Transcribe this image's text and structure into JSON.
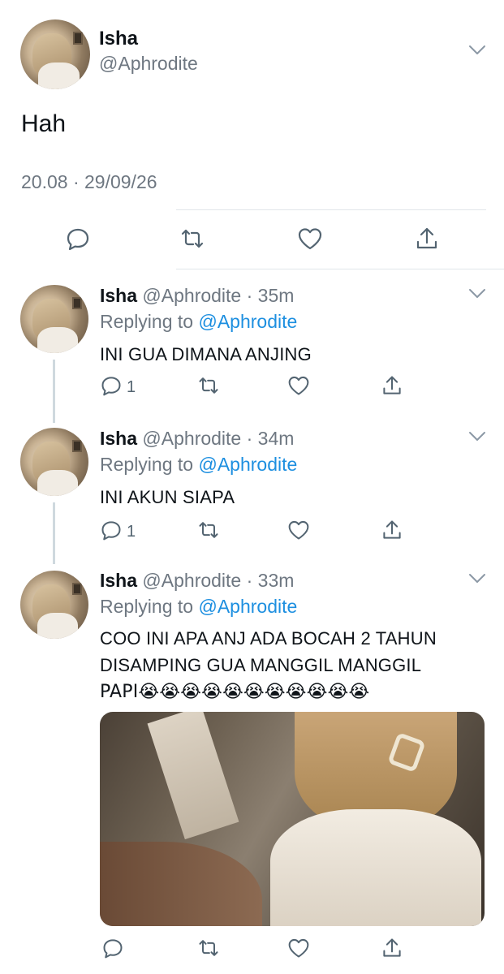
{
  "main_tweet": {
    "name": "Isha",
    "handle": "@Aphrodite",
    "text": "Hah",
    "timestamp": "20.08 · 29/09/26"
  },
  "replies": [
    {
      "name": "Isha",
      "meta": "@Aphrodite · 35m",
      "replying_prefix": "Replying to ",
      "replying_to": "@Aphrodite",
      "text": "INI GUA DIMANA ANJING",
      "reply_count": "1"
    },
    {
      "name": "Isha",
      "meta": "@Aphrodite · 34m",
      "replying_prefix": "Replying to ",
      "replying_to": "@Aphrodite",
      "text": "INI AKUN SIAPA",
      "reply_count": "1"
    },
    {
      "name": "Isha",
      "meta": "@Aphrodite · 33m",
      "replying_prefix": "Replying to ",
      "replying_to": "@Aphrodite",
      "text_line1": "COO INI APA ANJ ADA BOCAH 2 TAHUN",
      "text_line2": "DISAMPING GUA MANGGIL MANGGIL",
      "text_line3": "PAPI😭😭😭😭😭😭😭😭😭😭😭"
    }
  ],
  "icons": {
    "reply": "reply-icon",
    "retweet": "retweet-icon",
    "like": "heart-icon",
    "share": "share-icon",
    "more": "chevron-down-icon"
  },
  "colors": {
    "link": "#1d8fe0",
    "muted": "#6e7781",
    "text": "#0f1419"
  }
}
